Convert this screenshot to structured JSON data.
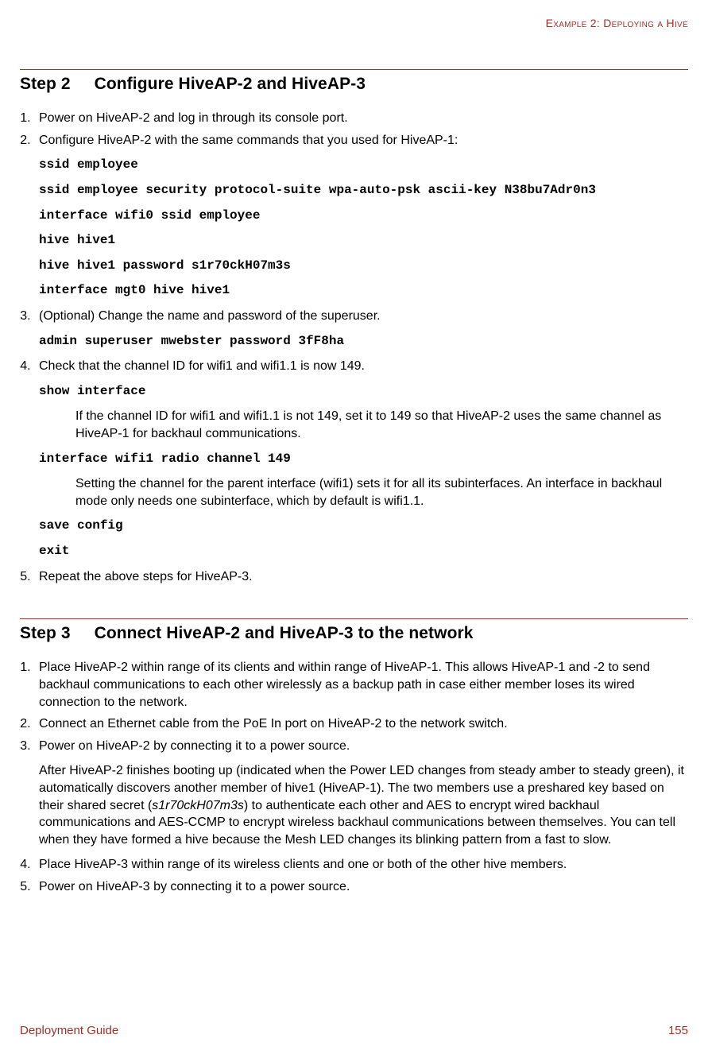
{
  "header": {
    "running_head": "Example 2: Deploying a Hive"
  },
  "step2": {
    "label": "Step 2",
    "title": "Configure HiveAP-2 and HiveAP-3",
    "li1": "Power on HiveAP-2 and log in through its console port.",
    "li2": "Configure HiveAP-2 with the same commands that you used for HiveAP-1:",
    "cmds2": {
      "a": "ssid employee",
      "b": "ssid employee security protocol-suite wpa-auto-psk ascii-key N38bu7Adr0n3",
      "c": "interface wifi0 ssid employee",
      "d": "hive hive1",
      "e": "hive hive1 password s1r70ckH07m3s",
      "f": "interface mgt0 hive hive1"
    },
    "li3": "(Optional) Change the name and password of the superuser.",
    "cmd3": "admin superuser mwebster password 3fF8ha",
    "li4": "Check that the channel ID for wifi1 and wifi1.1 is now 149.",
    "cmd4a": "show interface",
    "note4a": "If the channel ID for wifi1 and wifi1.1 is not 149, set it to 149 so that HiveAP-2 uses the same channel as HiveAP-1 for backhaul communications.",
    "cmd4b": "interface wifi1 radio channel 149",
    "note4b": "Setting the channel for the parent interface (wifi1) sets it for all its subinterfaces. An interface in backhaul mode only needs one subinterface, which by default is wifi1.1.",
    "cmd4c": "save config",
    "cmd4d": "exit",
    "li5": "Repeat the above steps for HiveAP-3."
  },
  "step3": {
    "label": "Step 3",
    "title": "Connect HiveAP-2 and HiveAP-3 to the network",
    "li1": "Place HiveAP-2 within range of its clients and within range of HiveAP-1. This allows HiveAP-1 and -2 to send backhaul communications to each other wirelessly as a backup path in case either member loses its wired connection to the network.",
    "li2": "Connect an Ethernet cable from the PoE In port on HiveAP-2 to the network switch.",
    "li3": "Power on HiveAP-2 by connecting it to a power source.",
    "p3a_pre": "After HiveAP-2 finishes booting up (indicated when the Power LED changes from steady amber to steady green), it automatically discovers another member of hive1 (HiveAP-1). The two members use a preshared key based on their shared secret (",
    "p3a_secret": "s1r70ckH07m3s",
    "p3a_post": ") to authenticate each other and AES to encrypt wired backhaul communications and AES-CCMP to encrypt wireless backhaul communications between themselves. You can tell when they have formed a hive because the Mesh LED changes its blinking pattern from a fast to slow.",
    "li4": "Place HiveAP-3 within range of its wireless clients and one or both of the other hive members.",
    "li5": "Power on HiveAP-3 by connecting it to a power source."
  },
  "footer": {
    "left": "Deployment Guide",
    "right": "155"
  }
}
